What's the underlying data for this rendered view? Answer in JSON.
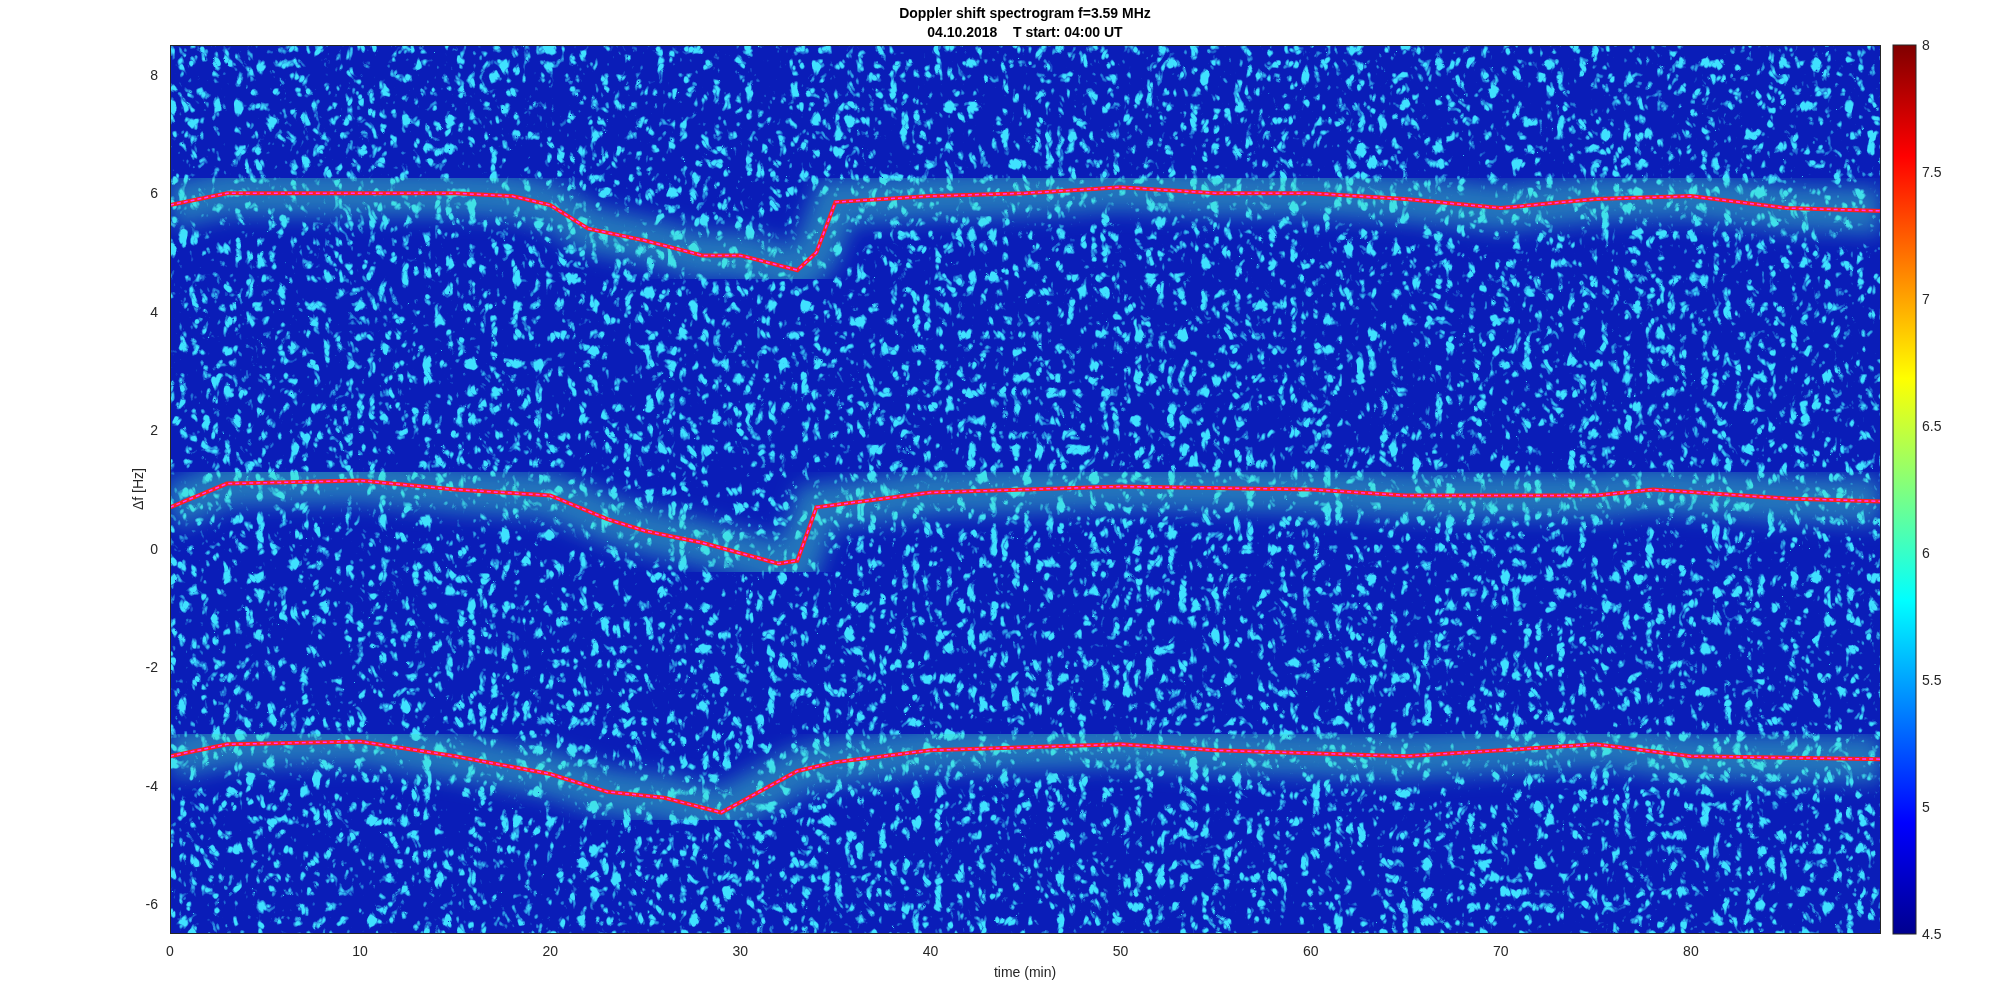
{
  "figure": {
    "title": "Doppler shift spectrogram f=3.59 MHz",
    "subtitle": "04.10.2018    T start: 04:00 UT",
    "y_axis": {
      "label": "Δf [Hz]",
      "ticks": [
        "8",
        "6",
        "4",
        "2",
        "0",
        "-2",
        "-4",
        "-6"
      ]
    },
    "x_axis": {
      "label": "time (min)",
      "ticks": [
        "0",
        "10",
        "20",
        "30",
        "40",
        "50",
        "60",
        "70",
        "80"
      ]
    },
    "colorbar": {
      "ticks": [
        "8",
        "7.5",
        "7",
        "6.5",
        "6",
        "5.5",
        "5",
        "4.5"
      ]
    }
  }
}
